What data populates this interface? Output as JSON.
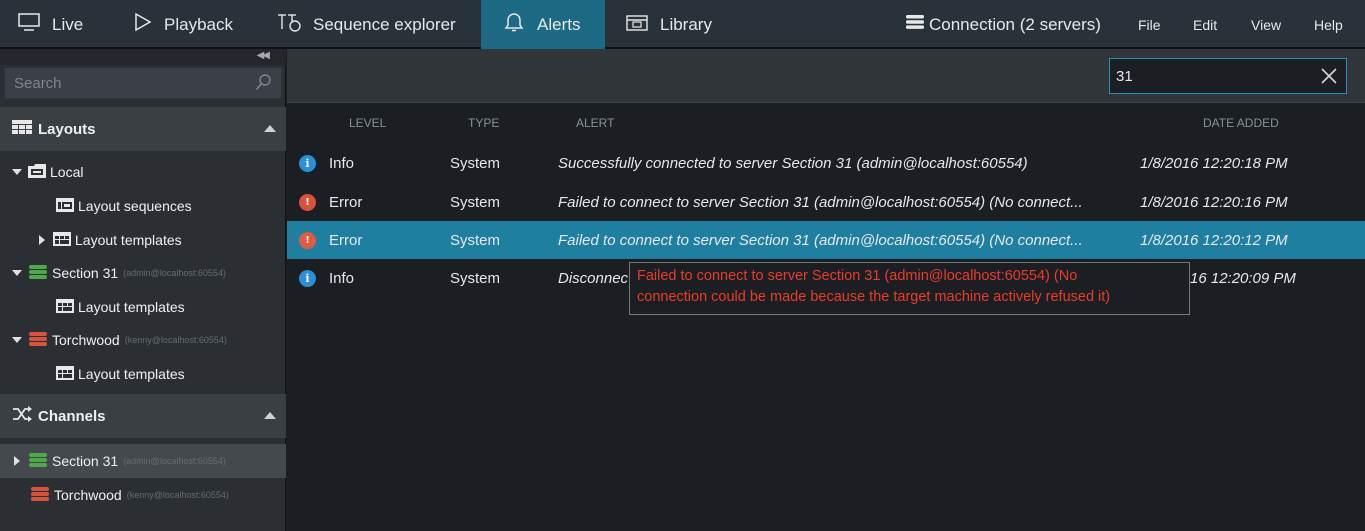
{
  "nav": {
    "live": "Live",
    "playback": "Playback",
    "sequence_explorer": "Sequence explorer",
    "alerts": "Alerts",
    "library": "Library",
    "connection": "Connection (2 servers)",
    "file": "File",
    "edit": "Edit",
    "view": "View",
    "help": "Help"
  },
  "sidebar": {
    "search_placeholder": "Search",
    "layouts_header": "Layouts",
    "channels_header": "Channels",
    "layouts_tree": {
      "local": "Local",
      "layout_sequences": "Layout sequences",
      "layout_templates_local": "Layout templates",
      "section31": "Section 31",
      "section31_sub": "(admin@localhost:60554)",
      "layout_templates_s31": "Layout templates",
      "torchwood": "Torchwood",
      "torchwood_sub": "(kenny@localhost:60554)",
      "layout_templates_tw": "Layout templates"
    },
    "channels_tree": {
      "section31": "Section 31",
      "section31_sub": "(admin@localhost:60554)",
      "torchwood": "Torchwood",
      "torchwood_sub": "(kenny@localhost:60554)"
    }
  },
  "alerts": {
    "filter_value": "31",
    "columns": {
      "level": "Level",
      "type": "Type",
      "alert": "Alert",
      "date_added": "Date added"
    },
    "rows": [
      {
        "level": "Info",
        "type": "System",
        "message": "Successfully connected to server Section 31 (admin@localhost:60554)",
        "date": "1/8/2016 12:20:18 PM"
      },
      {
        "level": "Error",
        "type": "System",
        "message": "Failed to connect to server Section 31 (admin@localhost:60554) (No connect...",
        "date": "1/8/2016 12:20:16 PM"
      },
      {
        "level": "Error",
        "type": "System",
        "message": "Failed to connect to server Section 31 (admin@localhost:60554) (No connect...",
        "date": "1/8/2016 12:20:12 PM"
      },
      {
        "level": "Info",
        "type": "System",
        "message": "Disconnec",
        "date": "16 12:20:09 PM"
      }
    ],
    "tooltip_line1": "Failed to connect to server Section 31 (admin@localhost:60554) (No",
    "tooltip_line2": "connection could be made because the target machine actively refused it)"
  },
  "colors": {
    "accent": "#1d6a84",
    "selected_row": "#1f7fa0",
    "tooltip_text": "#ee3a2a",
    "info": "#2b8fd6",
    "error": "#d9523b",
    "server_green": "#4fa84a",
    "server_red": "#d9523b"
  },
  "icons": {
    "live": "monitor-icon",
    "playback": "play-icon",
    "sequence_explorer": "sequence-icon",
    "alerts": "bell-icon",
    "library": "library-icon",
    "connection": "server-stack-icon",
    "search": "search-icon",
    "layouts": "layout-grid-icon",
    "channels": "shuffle-icon",
    "clear": "close-icon"
  }
}
